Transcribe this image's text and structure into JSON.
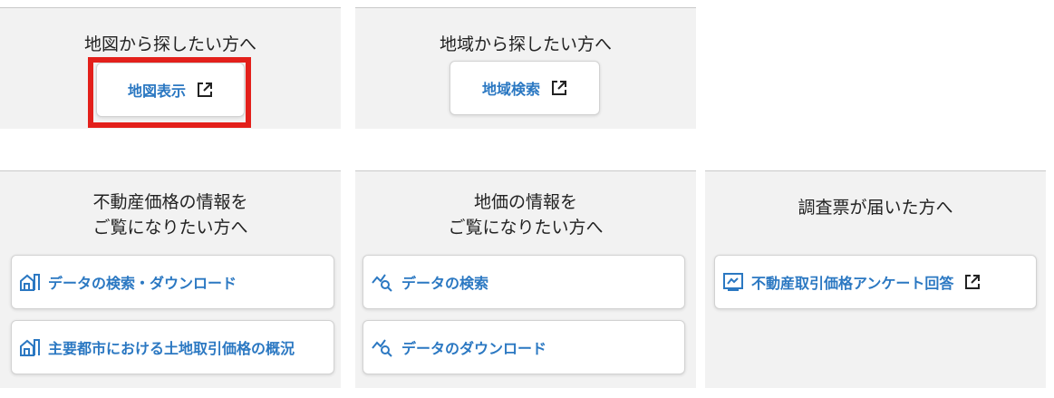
{
  "panels": {
    "map": {
      "title": "地図から探したい方へ",
      "button": "地図表示"
    },
    "region": {
      "title": "地域から探したい方へ",
      "button": "地域検索"
    },
    "realestate": {
      "title": "不動産価格の情報を\nご覧になりたい方へ",
      "buttons": [
        "データの検索・ダウンロード",
        "主要都市における土地取引価格の概況"
      ]
    },
    "landprice": {
      "title": "地価の情報を\nご覧になりたい方へ",
      "buttons": [
        "データの検索",
        "データのダウンロード"
      ]
    },
    "survey": {
      "title": "調査票が届いた方へ",
      "button": "不動産取引価格アンケート回答"
    }
  },
  "icons": {
    "external": "external-link-icon",
    "building": "building-icon",
    "chart": "chart-search-icon",
    "form": "form-icon"
  },
  "colors": {
    "accent": "#2b78c2",
    "highlight": "#e3201b",
    "panel_bg": "#f2f2f2"
  }
}
